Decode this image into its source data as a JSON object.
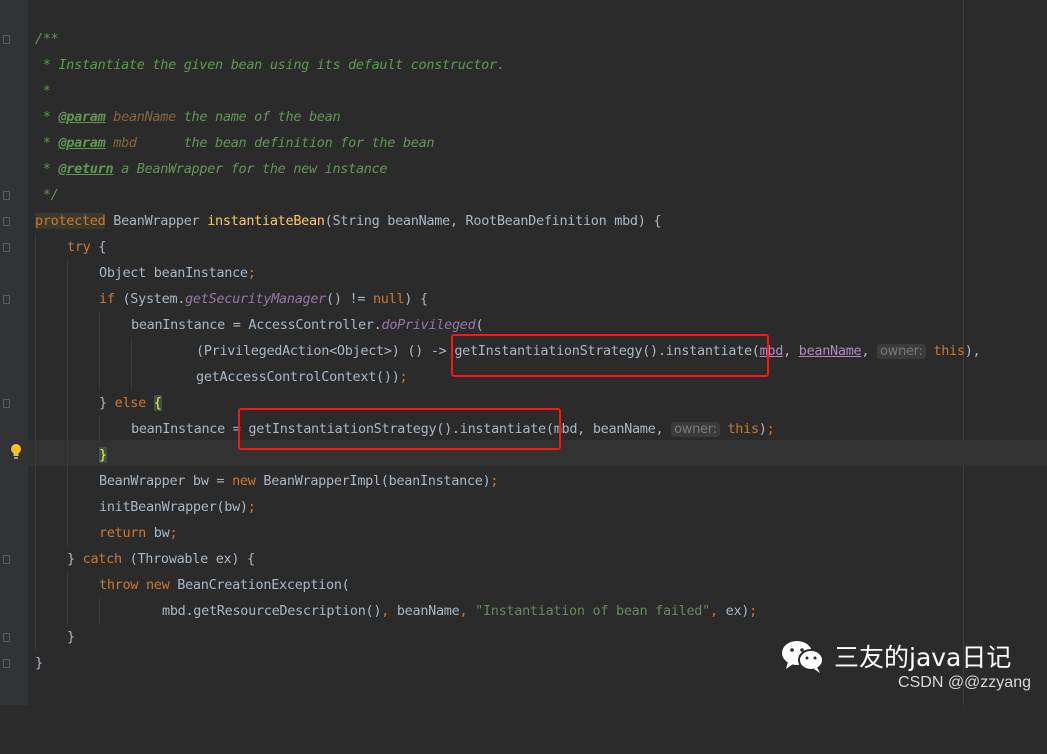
{
  "editor": {
    "lines": {
      "l1": "/**",
      "l2": " * Instantiate the given bean using its default constructor.",
      "l3": " *",
      "l4_a": " * ",
      "l4_tag": "@param",
      "l4_name": " beanName",
      "l4_desc": " the name of the bean",
      "l5_a": " * ",
      "l5_tag": "@param",
      "l5_name": " mbd",
      "l5_desc": "      the bean definition for the bean",
      "l6_a": " * ",
      "l6_tag": "@return",
      "l6_desc": " a BeanWrapper for the new instance",
      "l7": " */",
      "l8_kw": "protected",
      "l8_type": " BeanWrapper ",
      "l8_fn": "instantiateBean",
      "l8_rest": "(String beanName, RootBeanDefinition mbd) {",
      "l9_kw": "try",
      "l9_rest": " {",
      "l10_a": "Object beanInstance",
      "l10_semi": ";",
      "l11_kw": "if",
      "l11_a": " (System.",
      "l11_st": "getSecurityManager",
      "l11_b": "() != ",
      "l11_null": "null",
      "l11_c": ") {",
      "l12_a": "beanInstance = AccessController.",
      "l12_st": "doPrivileged",
      "l12_b": "(",
      "l13_a": "(PrivilegedAction<Object>) () -> ",
      "l13_b": "getInstantiationStrategy().instantiate(",
      "l13_mbd": "mbd",
      "l13_c": ", ",
      "l13_bn": "beanName",
      "l13_d": ", ",
      "l13_hint": "owner:",
      "l13_this": "this",
      "l13_e": "),",
      "l14_a": "getAccessControlContext())",
      "l14_semi": ";",
      "l15_a": "} ",
      "l15_kw": "else",
      "l15_sp": " ",
      "l15_br": "{",
      "l16_a": "beanInstance = getInstantiationStrategy().instantiate(mbd, beanName, ",
      "l16_hint": "owner:",
      "l16_sp": " ",
      "l16_this": "this",
      "l16_b": ")",
      "l16_semi": ";",
      "l17_br": "}",
      "l18_a": "BeanWrapper bw = ",
      "l18_kw": "new",
      "l18_b": " BeanWrapperImpl(beanInstance)",
      "l18_semi": ";",
      "l19_a": "initBeanWrapper(bw)",
      "l19_semi": ";",
      "l20_kw": "return",
      "l20_a": " bw",
      "l20_semi": ";",
      "l21_a": "} ",
      "l21_kw": "catch",
      "l21_b": " (Throwable ex) {",
      "l22_kw": "throw new",
      "l22_a": " BeanCreationException(",
      "l23_a": "mbd.getResourceDescription()",
      "l23_c1": ", ",
      "l23_b": "beanName",
      "l23_c2": ", ",
      "l23_str": "\"Instantiation of bean failed\"",
      "l23_c3": ", ",
      "l23_c": "ex)",
      "l23_semi": ";",
      "l24": "}",
      "l25": "}"
    }
  },
  "watermark": {
    "title": "三友的java日记",
    "icon": "wechat-icon",
    "credit": "CSDN @@zzyang"
  },
  "colors": {
    "background": "#2b2b2b",
    "comment": "#629755",
    "keyword": "#cc7832",
    "method": "#ffc66d",
    "highlight_box": "#ff1414"
  }
}
